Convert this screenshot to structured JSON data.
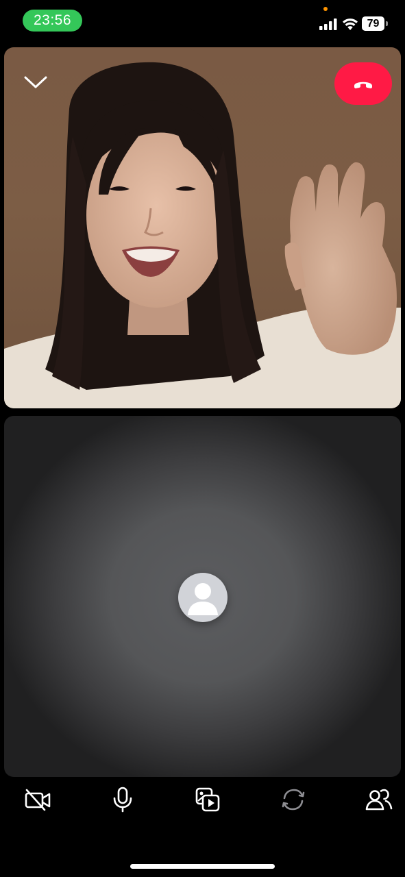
{
  "status_bar": {
    "time": "23:56",
    "battery_level": "79",
    "time_pill_color": "#34c759",
    "privacy_dot_color": "#ff9500",
    "icons": [
      "signal-bars-icon",
      "wifi-icon",
      "battery-icon"
    ]
  },
  "call": {
    "remote_tile": {
      "collapse_icon": "chevron-down-icon",
      "end_call_icon": "phone-hangup-icon",
      "end_call_color": "#ff1a45"
    },
    "local_tile": {
      "avatar_icon": "person-silhouette-icon"
    }
  },
  "toolbar": {
    "items": [
      {
        "icon": "video-off-icon"
      },
      {
        "icon": "microphone-icon"
      },
      {
        "icon": "share-screen-media-icon"
      },
      {
        "icon": "switch-camera-icon",
        "state": "disabled"
      },
      {
        "icon": "participants-icon"
      }
    ]
  }
}
